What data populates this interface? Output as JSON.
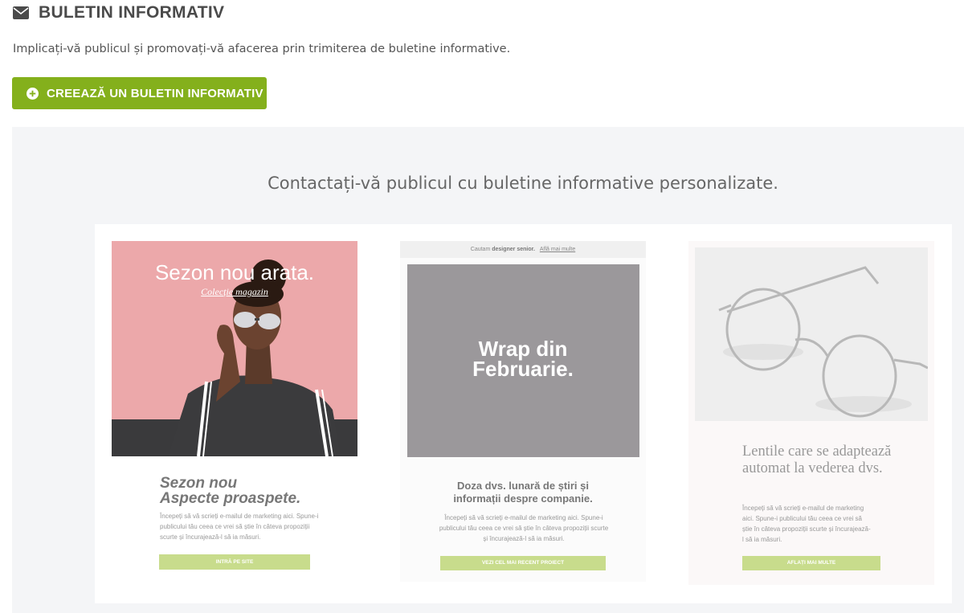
{
  "header": {
    "icon": "envelope-icon",
    "title": "BULETIN INFORMATIV"
  },
  "subtitle": "Implicați-vă publicul și promovați-vă afacerea prin trimiterea de buletine informative.",
  "create_button": {
    "icon": "plus-circle-icon",
    "label": "CREEAZĂ UN BULETIN INFORMATIV"
  },
  "panel": {
    "title": "Contactați-vă publicul cu buletine informative personalizate."
  },
  "templates": [
    {
      "hero_title": "Sezon nou arata.",
      "hero_subtitle": "Colecție magazin",
      "heading_line1": "Sezon nou",
      "heading_line2": "Aspecte proaspete.",
      "body": "Începeți să vă scrieți e-mailul de marketing aici. Spune-i publicului tău ceea ce vrei să știe în câteva propoziții scurte și încurajează-l să ia măsuri.",
      "button": "INTRĂ PE SITE"
    },
    {
      "top_prefix": "Cautam",
      "top_bold": "designer senior.",
      "top_link": "Află mai multe",
      "hero_line1": "Wrap din",
      "hero_line2": "Februarie.",
      "heading_line1": "Doza dvs. lunară de știri și",
      "heading_line2": "informații despre companie.",
      "body": "Începeți să vă scrieți e-mailul de marketing aici. Spune-i publicului tău ceea ce vrei să știe în câteva propoziții scurte și încurajează-l să ia măsuri.",
      "button": "VEZI CEL MAI RECENT PROIECT"
    },
    {
      "heading": "Lentile care se adaptează automat la vederea dvs.",
      "body": "Începeți să vă scrieți e-mailul de marketing aici. Spune-i publicului tău ceea ce vrei să știe în câteva propoziții scurte și încurajează-l să ia măsuri.",
      "button": "AFLAȚI MAI MULTE"
    }
  ],
  "colors": {
    "accent_green": "#84b01c",
    "light_green": "#c8dc8c",
    "pink": "#eca8aa",
    "grey_hero": "#9b989b",
    "panel_bg": "#f4f5f7"
  }
}
